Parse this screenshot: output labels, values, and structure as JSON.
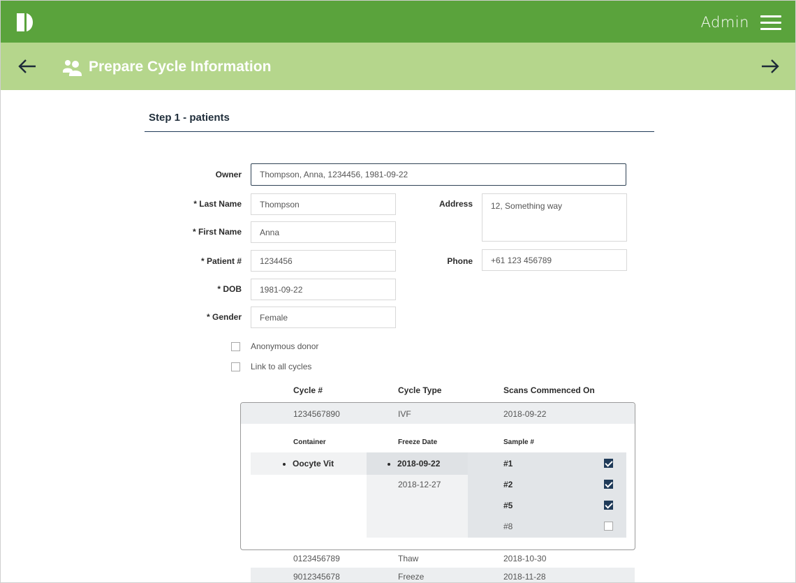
{
  "header": {
    "user_label": "Admin",
    "brand_color": "#5aa33c",
    "subbar_color": "#b5d68c"
  },
  "page": {
    "title": "Prepare Cycle Information",
    "step_title": "Step 1 - patients"
  },
  "form": {
    "owner_label": "Owner",
    "owner_value": "Thompson, Anna, 1234456, 1981-09-22",
    "last_name_label": "* Last Name",
    "last_name_value": "Thompson",
    "first_name_label": "* First Name",
    "first_name_value": "Anna",
    "patient_label": "* Patient #",
    "patient_value": "1234456",
    "dob_label": "* DOB",
    "dob_value": "1981-09-22",
    "gender_label": "* Gender",
    "gender_value": "Female",
    "address_label": "Address",
    "address_value": "12, Something way",
    "phone_label": "Phone",
    "phone_value": "+61 123 456789",
    "anonymous_label": "Anonymous donor",
    "anonymous_checked": false,
    "link_label": "Link to all cycles",
    "link_checked": false
  },
  "cycles": {
    "headers": [
      "Cycle #",
      "Cycle Type",
      "Scans Commenced On"
    ],
    "rows": [
      {
        "cycle": "1234567890",
        "type": "IVF",
        "date": "2018-09-22"
      },
      {
        "cycle": "0123456789",
        "type": "Thaw",
        "date": "2018-10-30"
      },
      {
        "cycle": "9012345678",
        "type": "Freeze",
        "date": "2018-11-28"
      }
    ],
    "detail": {
      "headers": [
        "Container",
        "Freeze Date",
        "Sample #"
      ],
      "container": "Oocyte Vit",
      "freeze_dates": [
        "2018-09-22",
        "2018-12-27"
      ],
      "samples": [
        {
          "label": "#1",
          "checked": true
        },
        {
          "label": "#2",
          "checked": true
        },
        {
          "label": "#5",
          "checked": true
        },
        {
          "label": "#8",
          "checked": false
        }
      ]
    }
  }
}
